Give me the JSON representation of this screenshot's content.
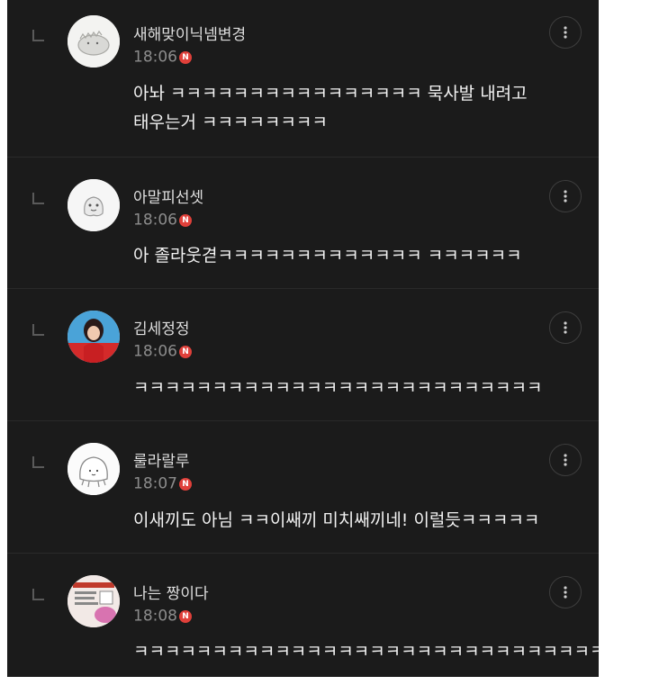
{
  "comments": [
    {
      "nickname": "새해맞이닉넴변경",
      "time": "18:06",
      "badge": "N",
      "text_lines": [
        "아놔 ㅋㅋㅋㅋㅋㅋㅋㅋㅋㅋㅋㅋㅋㅋㅋㅋ 묵사발 내려고",
        "태우는거 ㅋㅋㅋㅋㅋㅋㅋㅋ"
      ]
    },
    {
      "nickname": "아말피선셋",
      "time": "18:06",
      "badge": "N",
      "text_lines": [
        "아 졸라웃겯ㅋㅋㅋㅋㅋㅋㅋㅋㅋㅋㅋㅋㅋ ㅋㅋㅋㅋㅋㅋ"
      ]
    },
    {
      "nickname": "김세정정",
      "time": "18:06",
      "badge": "N",
      "text_lines": [
        "ㅋㅋㅋㅋㅋㅋㅋㅋㅋㅋㅋㅋㅋㅋㅋㅋㅋㅋㅋㅋㅋㅋㅋㅋㅋㅋ"
      ]
    },
    {
      "nickname": "룰라랄루",
      "time": "18:07",
      "badge": "N",
      "text_lines": [
        "이새끼도 아님 ㅋㅋ이쌔끼 미치쌔끼네! 이럴듯ㅋㅋㅋㅋㅋ"
      ]
    },
    {
      "nickname": "나는 짱이다",
      "time": "18:08",
      "badge": "N",
      "text_lines": [
        "ㅋㅋㅋㅋㅋㅋㅋㅋㅋㅋㅋㅋㅋㅋㅋㅋㅋㅋㅋㅋㅋㅋㅋㅋㅋㅋㅋㅋㅋㅋㅋㅋ"
      ]
    }
  ],
  "icons": {
    "reply": "reply-arrow-icon",
    "more": "more-vertical-icon",
    "badge": "new-badge-icon"
  },
  "colors": {
    "background": "#1b1b1b",
    "nickname": "#dedede",
    "time": "#8c8c8c",
    "text": "#f2f2f2",
    "badge": "#e0403a"
  }
}
